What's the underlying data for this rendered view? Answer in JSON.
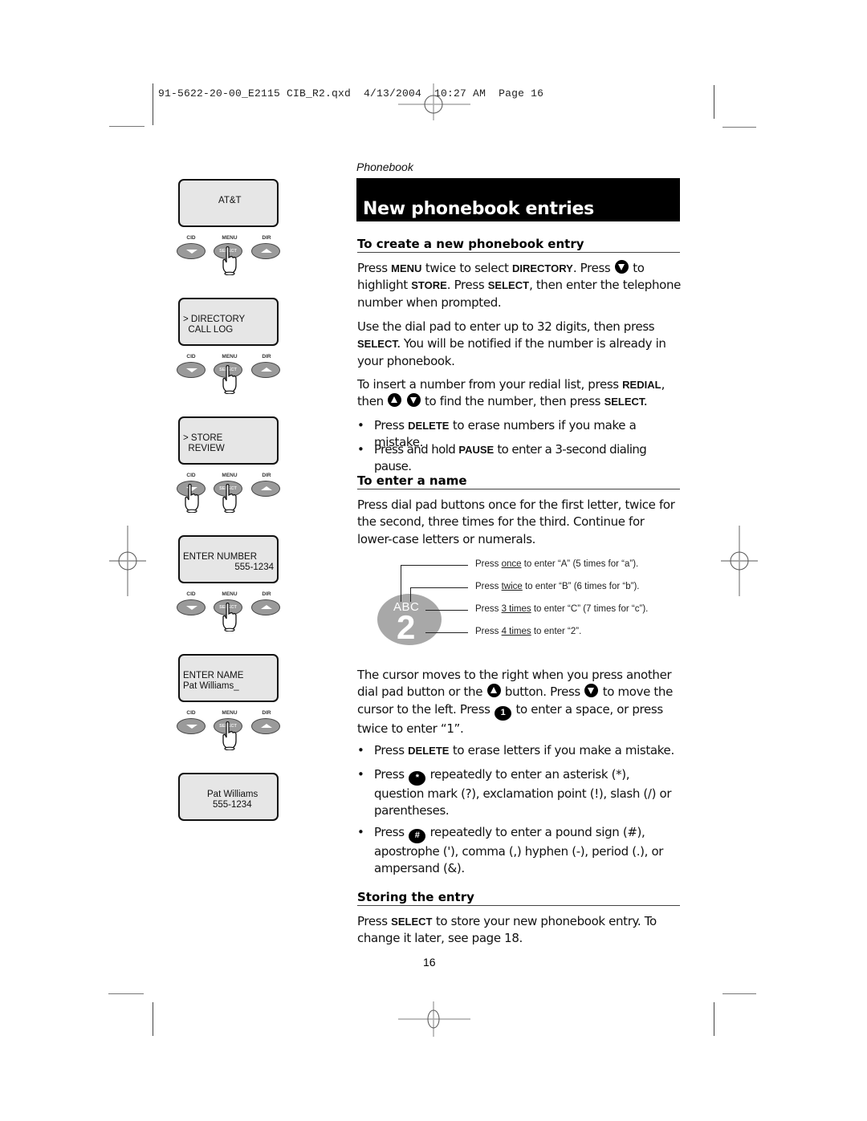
{
  "slug": "91-5622-20-00_E2115 CIB_R2.qxd  4/13/2004  10:27 AM  Page 16",
  "section_label": "Phonebook",
  "title": "New phonebook entries",
  "phone_steps": [
    {
      "line1": "AT&T",
      "line2": "",
      "pressed": [
        "MENU"
      ]
    },
    {
      "line1": "> DIRECTORY",
      "line2": "  CALL LOG",
      "pressed": [
        "MENU"
      ]
    },
    {
      "line1": "> STORE",
      "line2": "  REVIEW",
      "pressed": [
        "CID",
        "MENU"
      ]
    },
    {
      "line1": "ENTER NUMBER",
      "line2": "555-1234",
      "pressed": [
        "MENU"
      ]
    },
    {
      "line1": "ENTER NAME",
      "line2": "Pat Williams_",
      "pressed": [
        "MENU"
      ]
    },
    {
      "line1": "Pat Williams",
      "line2": "555-1234",
      "pressed": []
    }
  ],
  "keys": {
    "cid": "CID",
    "menu": "MENU",
    "dir": "DIR",
    "select": "SELECT"
  },
  "create": {
    "heading": "To create a new phonebook entry",
    "p1": {
      "a": "Press ",
      "k1": "MENU",
      "b": " twice to select ",
      "k2": "DIRECTORY",
      "c": ". Press ",
      "d": " to highlight ",
      "k3": "STORE",
      "e": ". Press ",
      "k4": "SELECT",
      "f": ", then enter the telephone number when prompted."
    },
    "p2": {
      "a": "Use the dial pad to enter up to 32 digits, then press ",
      "k1": "SELECT.",
      "b": " You will be notified if the number is already in your phonebook."
    },
    "p3": {
      "a": "To insert a number from your redial list, press ",
      "k1": "REDIAL",
      "b": ", then ",
      "c": " to find the number, then press ",
      "k2": "SELECT."
    },
    "bullets": [
      {
        "a": "Press ",
        "k": "DELETE",
        "b": " to erase numbers if you make a mistake."
      },
      {
        "a": "Press and hold ",
        "k": "PAUSE",
        "b": " to enter a 3-second dialing pause."
      }
    ]
  },
  "name": {
    "heading": "To enter a name",
    "p1": "Press dial pad buttons once for the first letter, twice for the second, three times for the third. Continue for lower-case letters or numerals.",
    "key_letters": "ABC",
    "key_digit": "2",
    "callouts": [
      {
        "a": "Press ",
        "u": "once",
        "b": " to enter “A” (5 times for “a”)."
      },
      {
        "a": "Press ",
        "u": "twice",
        "b": " to enter “B” (6 times for “b”)."
      },
      {
        "a": "Press ",
        "u": "3 times",
        "b": " to enter “C” (7 times for “c”)."
      },
      {
        "a": "Press ",
        "u": "4 times",
        "b": " to enter “2”."
      }
    ],
    "p2": {
      "a": "The cursor moves to the right when you press another dial pad button or the ",
      "b": " button. Press ",
      "c": " to move the cursor to the left. Press ",
      "one": "1",
      "d": " to enter a space, or press twice to enter “1”."
    },
    "bullets": [
      {
        "a": "Press ",
        "k": "DELETE",
        "b": " to erase letters if you make a mistake."
      },
      {
        "a": "Press ",
        "icon": "*",
        "b": " repeatedly to enter an asterisk (*), question mark (?), exclamation point (!), slash (/) or parentheses."
      },
      {
        "a": "Press ",
        "icon": "#",
        "b": " repeatedly to enter a pound sign (#), apostrophe ('), comma (,) hyphen (-), period (.), or ampersand (&)."
      }
    ]
  },
  "storing": {
    "heading": "Storing the entry",
    "p1": {
      "a": "Press ",
      "k": "SELECT",
      "b": " to store your new phonebook entry. To change it later, see page 18."
    }
  },
  "page_number": "16",
  "bullet_char": "•"
}
